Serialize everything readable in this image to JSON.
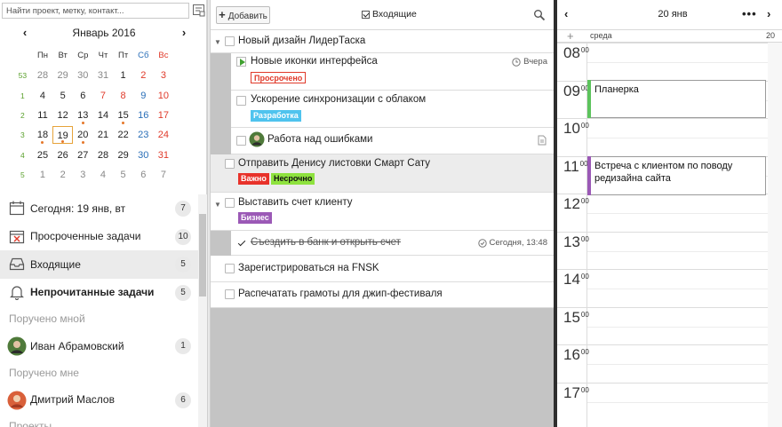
{
  "left": {
    "search_placeholder": "Найти проект, метку, контакт...",
    "calendar": {
      "title": "Январь 2016",
      "weekdays": [
        "Пн",
        "Вт",
        "Ср",
        "Чт",
        "Пт",
        "Сб",
        "Вс"
      ],
      "weeks": [
        {
          "wk": "53",
          "days": [
            "28",
            "29",
            "30",
            "31",
            "1",
            "2",
            "3"
          ]
        },
        {
          "wk": "1",
          "days": [
            "4",
            "5",
            "6",
            "7",
            "8",
            "9",
            "10"
          ]
        },
        {
          "wk": "2",
          "days": [
            "11",
            "12",
            "13",
            "14",
            "15",
            "16",
            "17"
          ]
        },
        {
          "wk": "3",
          "days": [
            "18",
            "19",
            "20",
            "21",
            "22",
            "23",
            "24"
          ]
        },
        {
          "wk": "4",
          "days": [
            "25",
            "26",
            "27",
            "28",
            "29",
            "30",
            "31"
          ]
        },
        {
          "wk": "5",
          "days": [
            "1",
            "2",
            "3",
            "4",
            "5",
            "6",
            "7"
          ]
        }
      ]
    },
    "nav": {
      "today": {
        "label": "Сегодня: 19 янв, вт",
        "count": "7"
      },
      "overdue": {
        "label": "Просроченные задачи",
        "count": "10"
      },
      "inbox": {
        "label": "Входящие",
        "count": "5"
      },
      "unread": {
        "label": "Непрочитанные задачи",
        "count": "5"
      },
      "section_assigned_by_me": "Поручено мной",
      "person1": {
        "name": "Иван Абрамовский",
        "count": "1"
      },
      "section_assigned_to_me": "Поручено мне",
      "person2": {
        "name": "Дмитрий Маслов",
        "count": "6"
      },
      "section_projects": "Проекты"
    }
  },
  "middle": {
    "add_label": "Добавить",
    "filter_label": "Входящие",
    "tasks": {
      "t1": {
        "title": "Новый дизайн ЛидерТаска"
      },
      "t2": {
        "title": "Новые иконки интерфейса",
        "tag": "Просрочено",
        "meta": "Вчера"
      },
      "t3": {
        "title": "Ускорение синхронизации с облаком",
        "tag": "Разработка"
      },
      "t4": {
        "title": "Работа над ошибками"
      },
      "t5": {
        "title": "Отправить Денису листовки Смарт Сату",
        "tag1": "Важно",
        "tag2": "Несрочно"
      },
      "t6": {
        "title": "Выставить счет клиенту",
        "tag": "Бизнес"
      },
      "t7": {
        "title": "Съездить в банк и открыть счет",
        "meta": "Сегодня, 13:48"
      },
      "t8": {
        "title": "Зарегистрироваться на FNSK"
      },
      "t9": {
        "title": "Распечатать грамоты для джип-фестиваля"
      }
    },
    "colors": {
      "overdue": "#e03a2a",
      "dev": "#4fc3ee",
      "important": "#e8322a",
      "not_urgent": "#8ee23e",
      "business": "#9b59b6"
    }
  },
  "right": {
    "day_title": "20 янв",
    "weekday": "среда",
    "day_num": "20",
    "hours": [
      "08",
      "09",
      "10",
      "11",
      "12",
      "13",
      "14",
      "15",
      "16",
      "17"
    ],
    "minutes": "00",
    "events": [
      {
        "title": "Планерка",
        "color": "#5cc35c"
      },
      {
        "title": "Встреча с клиентом по поводу редизайна сайта",
        "color": "#9b59b6"
      }
    ]
  }
}
